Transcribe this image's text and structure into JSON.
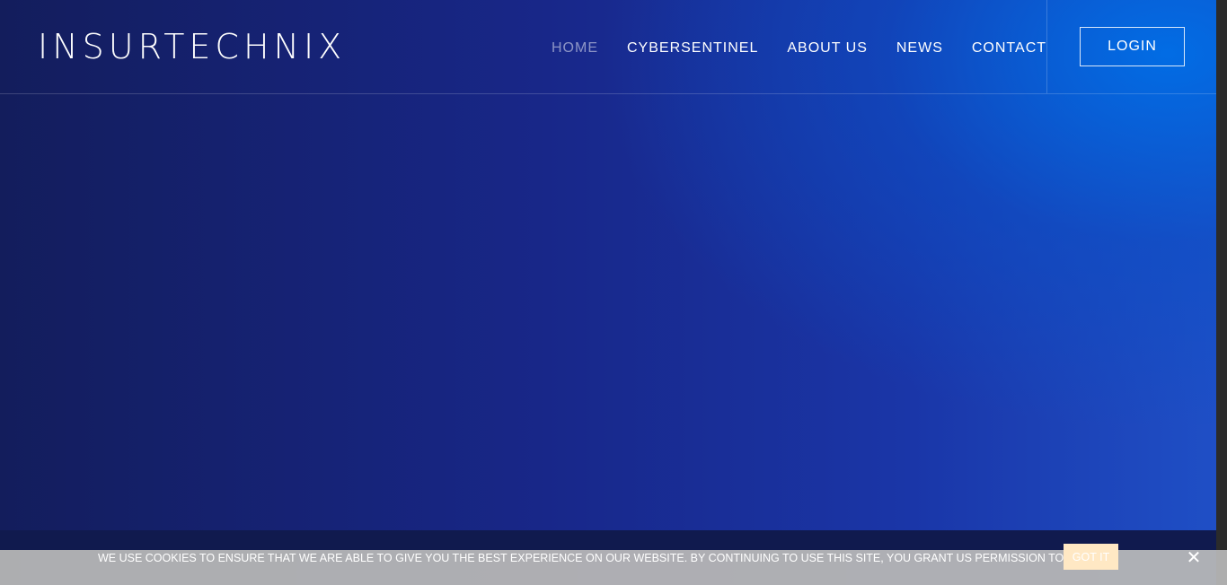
{
  "header": {
    "logo_text": "INSURTECHNIX",
    "nav": [
      {
        "label": "HOME",
        "active": true
      },
      {
        "label": "CYBERSENTINEL",
        "active": false
      },
      {
        "label": "ABOUT US",
        "active": false
      },
      {
        "label": "NEWS",
        "active": false
      },
      {
        "label": "CONTACT",
        "active": false
      }
    ],
    "login_label": "LOGIN"
  },
  "cookie_bar": {
    "message": "WE USE COOKIES TO ENSURE THAT WE ARE ABLE TO GIVE YOU THE BEST EXPERIENCE ON OUR WEBSITE. BY CONTINUING TO USE THIS SITE, YOU GRANT US PERMISSION TO DO SO.",
    "accept_label": "GOT IT",
    "close_icon": "close-icon"
  },
  "colors": {
    "hero_dark": "#131d5c",
    "hero_mid": "#182789",
    "hero_bright": "#0066dd",
    "cookie_bar": "#b4b4b4",
    "accept_button": "#ffe8c4"
  }
}
